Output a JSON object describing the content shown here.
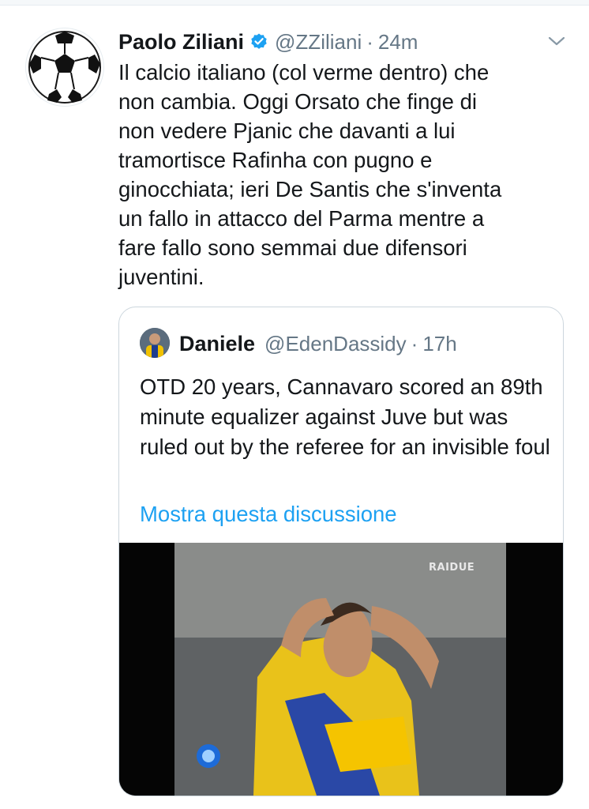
{
  "tweet": {
    "display_name": "Paolo Ziliani",
    "handle": "@ZZiliani",
    "separator": "·",
    "time": "24m",
    "text": "Il calcio italiano (col verme dentro) che\nnon cambia. Oggi Orsato che finge di\nnon vedere Pjanic che davanti a lui\ntramortisce Rafinha con pugno e\nginocchiata; ieri De Santis che s'inventa\nun fallo in attacco del Parma mentre a\nfare fallo sono semmai due difensori\njuventini."
  },
  "quote": {
    "display_name": "Daniele",
    "handle": "@EdenDassidy",
    "separator": "·",
    "time": "17h",
    "text": "OTD 20 years, Cannavaro scored an 89th minute equalizer against Juve but was ruled out by the referee for an invisible foul",
    "link_label": "Mostra questa discussione",
    "media": {
      "channel_watermark": "RAIDUE"
    }
  },
  "colors": {
    "text_primary": "#14171a",
    "text_secondary": "#657786",
    "link": "#1da1f2",
    "verified": "#1da1f2",
    "border": "#ccd6dd"
  },
  "icons": {
    "verified": "verified-badge-icon",
    "caret": "chevron-down-icon"
  }
}
